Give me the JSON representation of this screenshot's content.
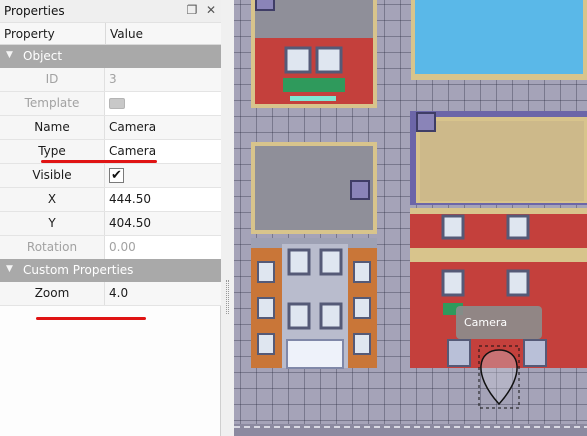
{
  "panel": {
    "title": "Properties",
    "float_glyph": "❐",
    "close_glyph": "✕"
  },
  "table": {
    "col_property": "Property",
    "col_value": "Value"
  },
  "groups": {
    "object": "Object",
    "custom": "Custom Properties"
  },
  "object_rows": {
    "id": {
      "label": "ID",
      "value": "3"
    },
    "template": {
      "label": "Template",
      "value": ""
    },
    "name": {
      "label": "Name",
      "value": "Camera"
    },
    "type": {
      "label": "Type",
      "value": "Camera"
    },
    "visible": {
      "label": "Visible",
      "checked": true,
      "check_glyph": "✔"
    },
    "x": {
      "label": "X",
      "value": "444.50"
    },
    "y": {
      "label": "Y",
      "value": "404.50"
    },
    "rotation": {
      "label": "Rotation",
      "value": "0.00"
    }
  },
  "custom_rows": {
    "zoom": {
      "label": "Zoom",
      "value": "4.0"
    }
  },
  "map": {
    "camera_label": "Camera"
  },
  "colors": {
    "annotation_red": "#e01414",
    "group_header": "#a9a9a9",
    "map_ground": "#a5a3b8",
    "water": "#5ab8e8",
    "brick": "#c4403c"
  }
}
